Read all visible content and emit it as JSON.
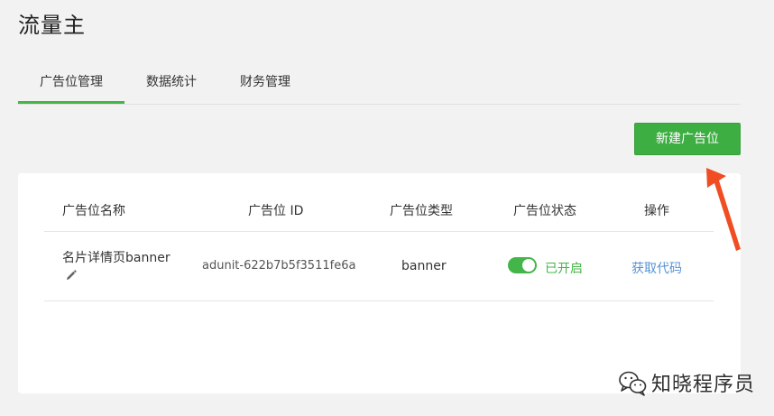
{
  "page": {
    "title": "流量主"
  },
  "tabs": [
    {
      "label": "广告位管理",
      "active": true
    },
    {
      "label": "数据统计",
      "active": false
    },
    {
      "label": "财务管理",
      "active": false
    }
  ],
  "toolbar": {
    "new_button_label": "新建广告位"
  },
  "table": {
    "headers": {
      "name": "广告位名称",
      "id": "广告位 ID",
      "type": "广告位类型",
      "status": "广告位状态",
      "action": "操作"
    },
    "rows": [
      {
        "name": "名片详情页banner",
        "id": "adunit-622b7b5f3511fe6a",
        "type": "banner",
        "status_on": true,
        "status_label": "已开启",
        "action_label": "获取代码"
      }
    ]
  },
  "icons": {
    "edit": "pencil-icon",
    "annotation": "red-arrow-icon",
    "watermark_logo": "wechat-logo-icon"
  },
  "colors": {
    "accent_green": "#44b549",
    "button_green": "#3dae42",
    "link_blue": "#5592d6",
    "arrow_red": "#f04d23",
    "background": "#f2f2f2"
  },
  "watermark": {
    "text": "知晓程序员"
  }
}
